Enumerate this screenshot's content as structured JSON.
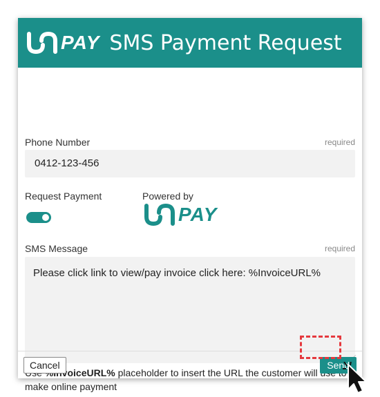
{
  "header": {
    "logo_text": "PAY",
    "title": "SMS Payment Request"
  },
  "phone": {
    "label": "Phone Number",
    "required": "required",
    "value": "0412-123-456"
  },
  "request_payment": {
    "label": "Request Payment",
    "enabled": true
  },
  "powered": {
    "label": "Powered by",
    "logo_text": "PAY"
  },
  "sms": {
    "label": "SMS Message",
    "required": "required",
    "value": "Please click link to view/pay invoice click here: %InvoiceURL%"
  },
  "hint": {
    "prefix": "Use ",
    "placeholder": "%InvoiceURL%",
    "suffix": " placeholder to insert the URL the customer will use to make online payment"
  },
  "footer": {
    "cancel_label": "Cancel",
    "send_label": "Send"
  },
  "colors": {
    "accent": "#1b8f8a",
    "highlight": "#e5393e"
  }
}
